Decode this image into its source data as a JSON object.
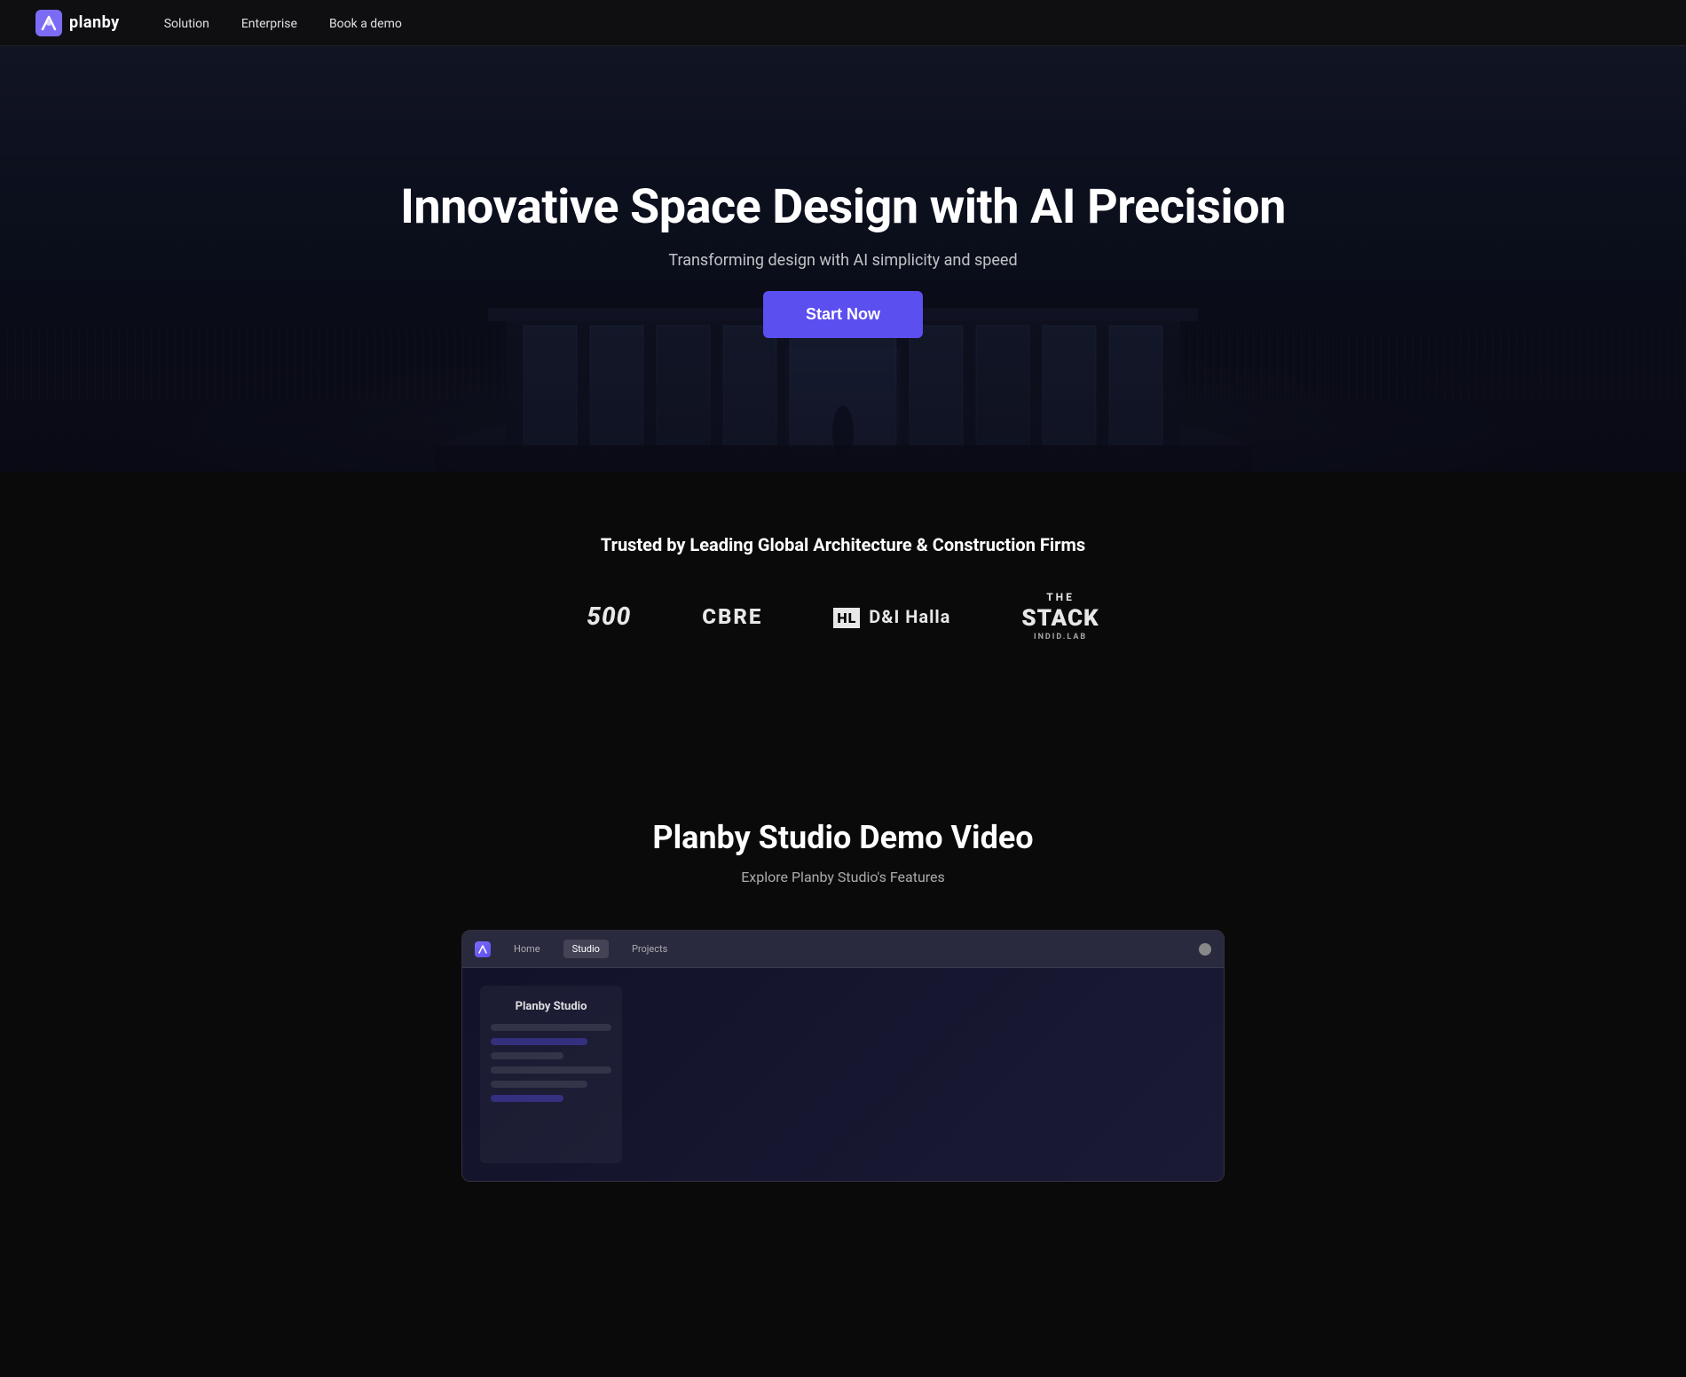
{
  "nav": {
    "logo_text": "planby",
    "links": [
      {
        "label": "Solution",
        "href": "#"
      },
      {
        "label": "Enterprise",
        "href": "#"
      },
      {
        "label": "Book a demo",
        "href": "#"
      }
    ]
  },
  "hero": {
    "title": "Innovative Space Design with AI Precision",
    "subtitle": "Transforming design with AI simplicity and speed",
    "cta_label": "Start Now"
  },
  "trusted": {
    "heading": "Trusted by Leading Global Architecture & Construction Firms",
    "logos": [
      {
        "id": "500",
        "text": "500",
        "style": "logo-500"
      },
      {
        "id": "cbre",
        "text": "CBRE",
        "style": "logo-cbre"
      },
      {
        "id": "hl",
        "text": "HL D&I Halla",
        "style": "logo-hl"
      },
      {
        "id": "stack",
        "the": "THE",
        "main": "stack",
        "sub": "indid.lab",
        "style": "logo-stack"
      }
    ]
  },
  "demo": {
    "title": "Planby Studio Demo Video",
    "subtitle": "Explore Planby Studio's Features",
    "browser": {
      "tabs": [
        {
          "label": "Home",
          "active": false
        },
        {
          "label": "Studio",
          "active": true
        },
        {
          "label": "Projects",
          "active": false
        }
      ],
      "sidebar_label": "Planby Studio"
    }
  },
  "colors": {
    "cta_bg": "#5b4ff0",
    "nav_bg": "#0f0f12",
    "page_bg": "#0a0a0a"
  }
}
